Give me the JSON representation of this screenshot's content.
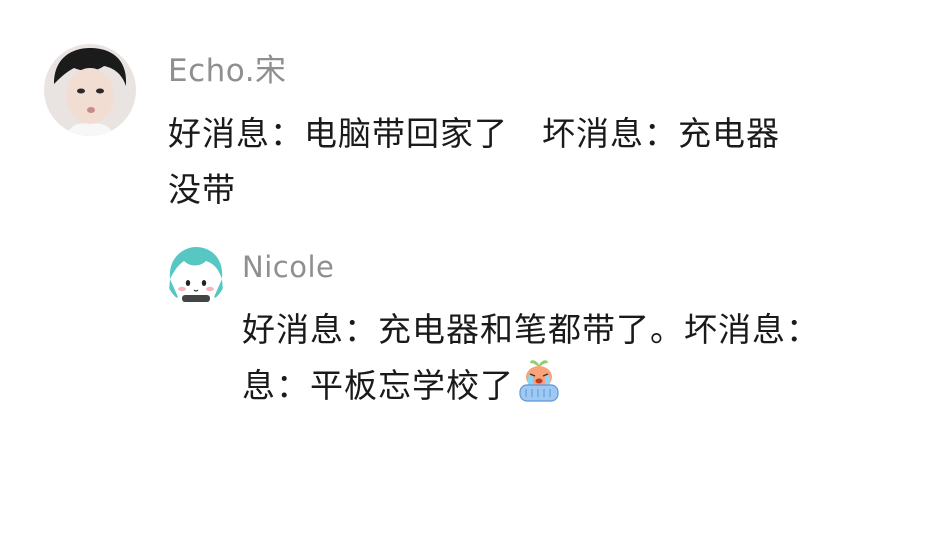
{
  "comments": [
    {
      "username": "Echo.宋",
      "lines": [
        "好消息：电脑带回家了　坏消息：充电器",
        "没带"
      ]
    }
  ],
  "replies": [
    {
      "username": "Nicole",
      "lines": [
        "好消息：充电器和笔都带了。坏消息：",
        "息：平板忘学校了"
      ],
      "emoji": "crying-face-emoji"
    }
  ],
  "colors": {
    "username": "#8f8f8f",
    "text": "#1a1a1a",
    "background": "#ffffff"
  }
}
